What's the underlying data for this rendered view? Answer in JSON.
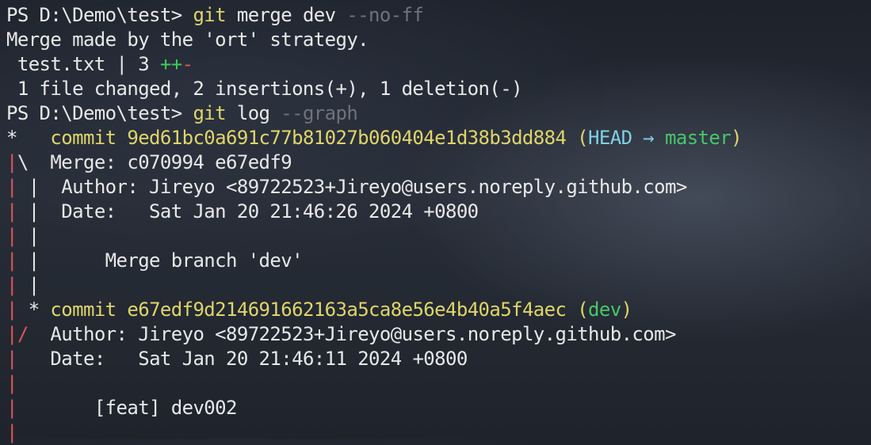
{
  "prompt": "PS D:\\Demo\\test> ",
  "cmd1": {
    "git": "git",
    "args": " merge dev ",
    "flag": "--no-ff"
  },
  "merge_msg": "Merge made by the 'ort' strategy.",
  "diffstat": {
    "file": " test.txt | 3 ",
    "plus": "++",
    "minus": "-"
  },
  "summary": " 1 file changed, 2 insertions(+), 1 deletion(-)",
  "cmd2": {
    "git": "git",
    "args": " log ",
    "flag": "--graph"
  },
  "commit1": {
    "star": "*   ",
    "label": "commit 9ed61bc0a691c77b81027b060404e1d38b3dd884",
    "open": " (",
    "head": "HEAD",
    "arrow": " → ",
    "branch": "master",
    "close": ")",
    "merge": "  Merge: c070994 e67edf9",
    "author": "Author: Jireyo <89722523+Jireyo@users.noreply.github.com>",
    "date": "Date:   Sat Jan 20 21:46:26 2024 +0800",
    "message": "    Merge branch 'dev'"
  },
  "commit2": {
    "star": " * ",
    "label": "commit e67edf9d214691662163a5ca8e56e4b40a5f4aec",
    "open": " (",
    "branch": "dev",
    "close": ")",
    "author": "Author: Jireyo <89722523+Jireyo@users.noreply.github.com>",
    "date": "Date:   Sat Jan 20 21:46:11 2024 +0800",
    "message": "    [feat] dev002"
  },
  "graph": {
    "pipe": "|",
    "pipe_pad": "| ",
    "pipe2": "|",
    "backslash": "\\",
    "slash": "/",
    "indent": "  ",
    "indent3": "   "
  },
  "colors": {
    "graph_red": "#e0535a",
    "commit_yellow": "#e0d56a",
    "head_cyan": "#7fd1e6",
    "branch_green": "#47c76a",
    "flag_gray": "#6e737b"
  }
}
